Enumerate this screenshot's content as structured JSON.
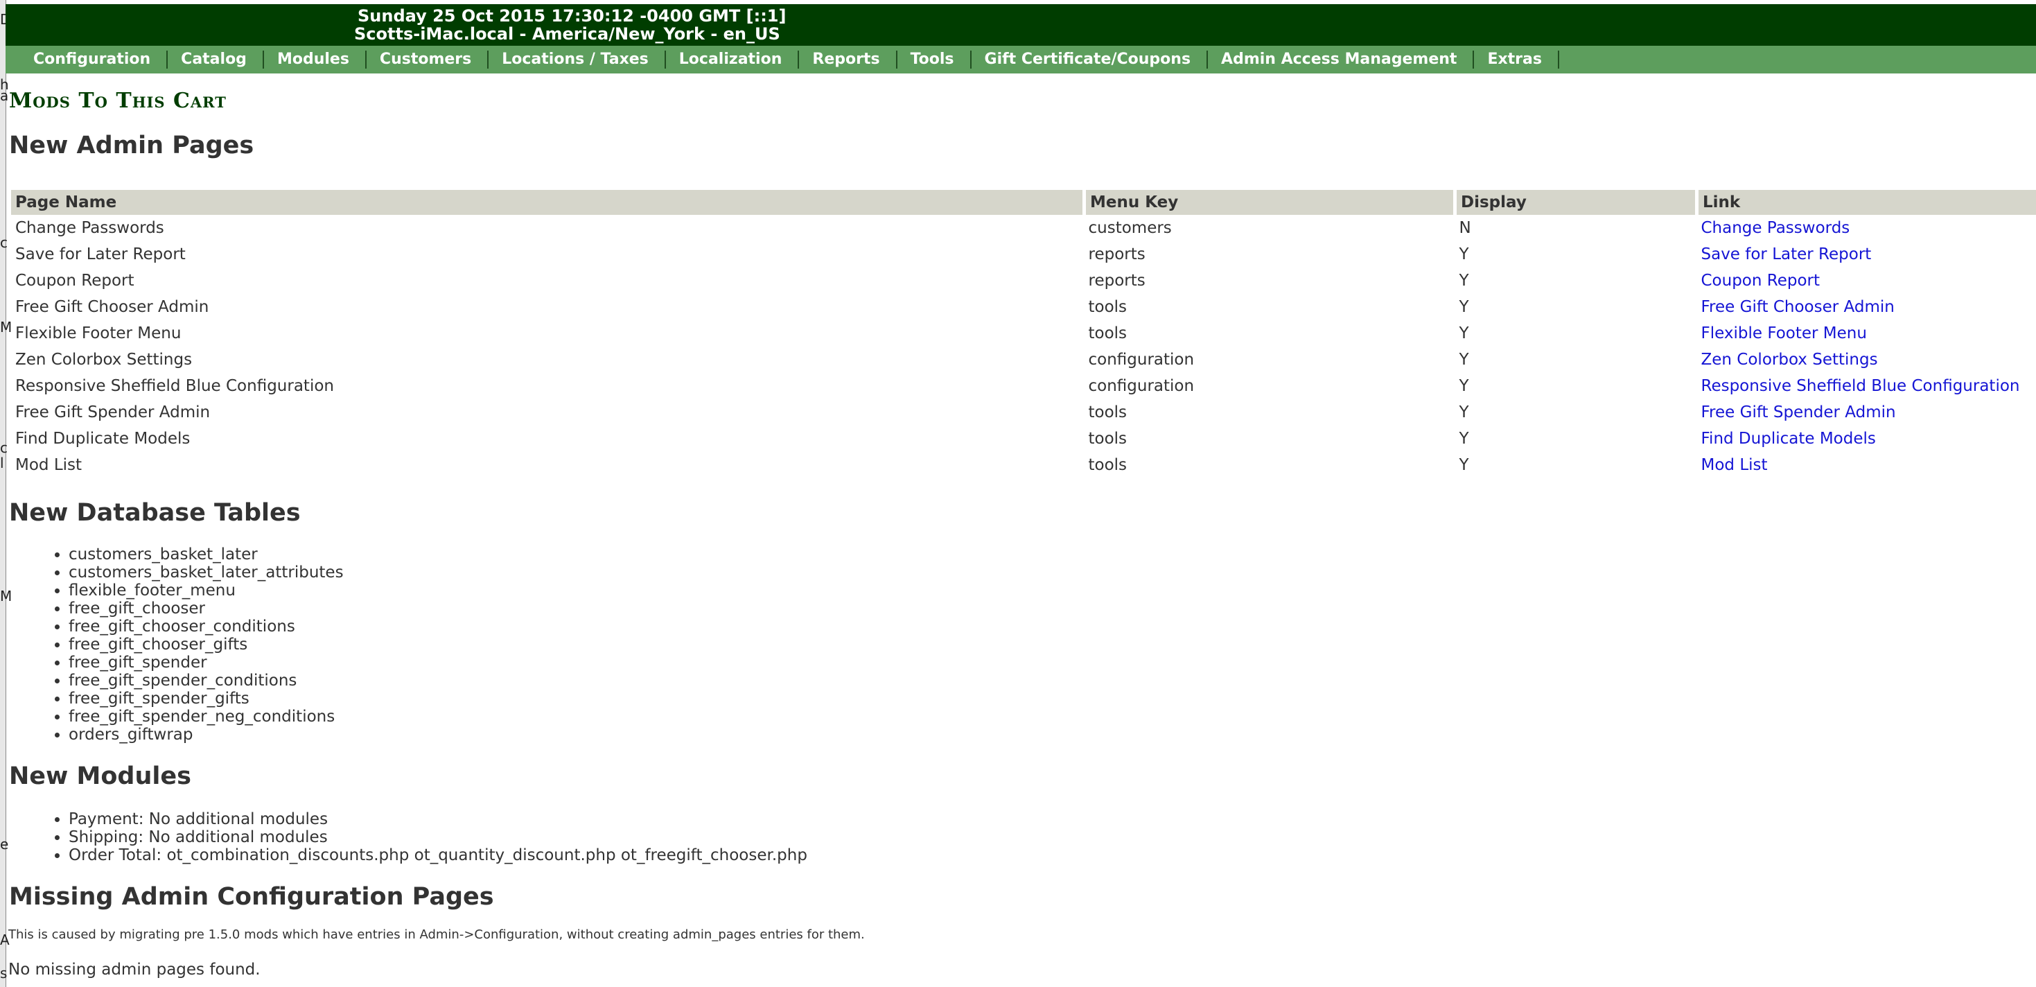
{
  "header": {
    "line1": "Sunday 25 Oct 2015 17:30:12 -0400 GMT [::1]",
    "line2": "Scotts-iMac.local - America/New_York - en_US"
  },
  "menu": [
    "Configuration",
    "Catalog",
    "Modules",
    "Customers",
    "Locations / Taxes",
    "Localization",
    "Reports",
    "Tools",
    "Gift Certificate/Coupons",
    "Admin Access Management",
    "Extras"
  ],
  "page_title": "Mods To This Cart",
  "admin_pages": {
    "heading": "New Admin Pages",
    "columns": [
      "Page Name",
      "Menu Key",
      "Display",
      "Link"
    ],
    "rows": [
      [
        "Change Passwords",
        "customers",
        "N",
        "Change Passwords"
      ],
      [
        "Save for Later Report",
        "reports",
        "Y",
        "Save for Later Report"
      ],
      [
        "Coupon Report",
        "reports",
        "Y",
        "Coupon Report"
      ],
      [
        "Free Gift Chooser Admin",
        "tools",
        "Y",
        "Free Gift Chooser Admin"
      ],
      [
        "Flexible Footer Menu",
        "tools",
        "Y",
        "Flexible Footer Menu"
      ],
      [
        "Zen Colorbox Settings",
        "configuration",
        "Y",
        "Zen Colorbox Settings"
      ],
      [
        "Responsive Sheffield Blue Configuration",
        "configuration",
        "Y",
        "Responsive Sheffield Blue Configuration"
      ],
      [
        "Free Gift Spender Admin",
        "tools",
        "Y",
        "Free Gift Spender Admin"
      ],
      [
        "Find Duplicate Models",
        "tools",
        "Y",
        "Find Duplicate Models"
      ],
      [
        "Mod List",
        "tools",
        "Y",
        "Mod List"
      ]
    ]
  },
  "db_tables": {
    "heading": "New Database Tables",
    "items": [
      "customers_basket_later",
      "customers_basket_later_attributes",
      "flexible_footer_menu",
      "free_gift_chooser",
      "free_gift_chooser_conditions",
      "free_gift_chooser_gifts",
      "free_gift_spender",
      "free_gift_spender_conditions",
      "free_gift_spender_gifts",
      "free_gift_spender_neg_conditions",
      "orders_giftwrap"
    ]
  },
  "modules": {
    "heading": "New Modules",
    "items": [
      "Payment: No additional modules",
      "Shipping: No additional modules",
      "Order Total: ot_combination_discounts.php ot_quantity_discount.php ot_freegift_chooser.php"
    ]
  },
  "missing": {
    "heading": "Missing Admin Configuration Pages",
    "note": "This is caused by migrating pre 1.5.0 mods which have entries in Admin->Configuration, without creating admin_pages entries for them.",
    "result": "No missing admin pages found."
  },
  "left_strip_glyphs": [
    "D",
    "h",
    "a",
    "c",
    "M",
    "c",
    "l",
    "M",
    "e",
    "A",
    "s"
  ],
  "colors": {
    "header_bg": "#003d00",
    "menu_bg": "#5d9e5d",
    "title": "#003d00",
    "link": "#1515d4",
    "table_header_bg": "#d6d6cb"
  }
}
